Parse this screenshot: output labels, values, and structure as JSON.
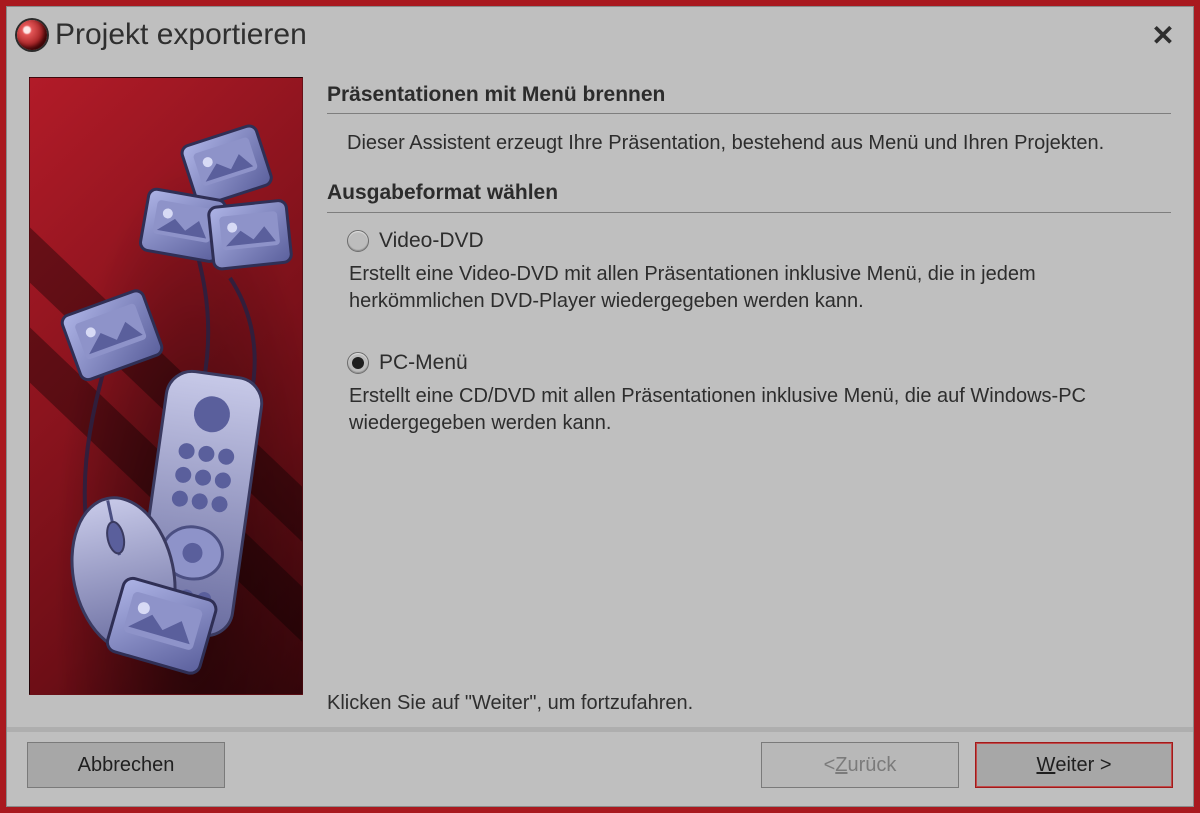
{
  "window": {
    "title": "Projekt exportieren",
    "close_glyph": "✕"
  },
  "section1": {
    "heading": "Präsentationen mit Menü brennen",
    "intro": "Dieser Assistent erzeugt Ihre Präsentation, bestehend aus Menü und Ihren Projekten."
  },
  "section2": {
    "heading": "Ausgabeformat wählen",
    "options": [
      {
        "id": "video-dvd",
        "label": "Video-DVD",
        "selected": false,
        "desc": "Erstellt eine Video-DVD mit allen Präsentationen inklusive Menü, die in jedem herkömmlichen DVD-Player wiedergegeben werden kann."
      },
      {
        "id": "pc-menu",
        "label": "PC-Menü",
        "selected": true,
        "desc": "Erstellt eine CD/DVD mit allen Präsentationen inklusive Menü, die auf Windows-PC wiedergegeben werden kann."
      }
    ]
  },
  "footer_hint": "Klicken Sie auf \"Weiter\", um fortzufahren.",
  "buttons": {
    "cancel": "Abbrechen",
    "back_prefix": "< ",
    "back_underline": "Z",
    "back_rest": "urück",
    "next_underline": "W",
    "next_rest": "eiter >"
  },
  "icons": {
    "app": "disc-eye-icon",
    "art_items": [
      "photo-stack-icon",
      "remote-icon",
      "mouse-icon"
    ]
  },
  "colors": {
    "accent": "#a11a1a",
    "panel": "#bfbfbf",
    "art_bg_from": "#b21b28",
    "art_bg_to": "#3a060b"
  }
}
